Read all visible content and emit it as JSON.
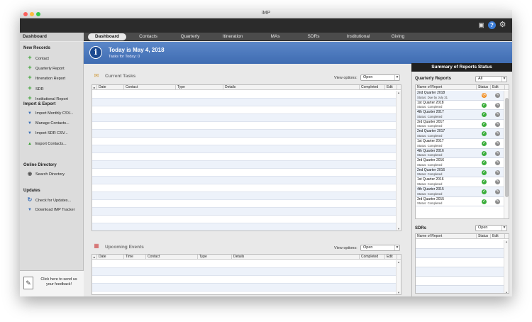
{
  "window": {
    "title": "iMP"
  },
  "toolbar": {
    "icons": [
      "inbox-icon",
      "help-icon",
      "gear-icon"
    ]
  },
  "sidebar": {
    "header": "Dashboard",
    "sections": [
      {
        "title": "New Records",
        "items": [
          {
            "label": "Contact",
            "icon": "plus-icon"
          },
          {
            "label": "Quarterly Report",
            "icon": "plus-icon"
          },
          {
            "label": "Itineration Report",
            "icon": "plus-icon"
          },
          {
            "label": "SDR",
            "icon": "plus-icon"
          },
          {
            "label": "Institutional Report",
            "icon": "plus-icon"
          }
        ]
      },
      {
        "title": "Import & Export",
        "items": [
          {
            "label": "Import Monthly CSV...",
            "icon": "download-icon"
          },
          {
            "label": "Manage Contacts...",
            "icon": "download-icon"
          },
          {
            "label": "Import SDR CSV...",
            "icon": "download-icon"
          },
          {
            "label": "Export Contacts...",
            "icon": "upload-icon"
          }
        ]
      },
      {
        "title": "Online Directory",
        "items": [
          {
            "label": "Search Directory",
            "icon": "search-icon"
          }
        ]
      },
      {
        "title": "Updates",
        "items": [
          {
            "label": "Check for Updates...",
            "icon": "refresh-icon"
          },
          {
            "label": "Download IMP Tracker",
            "icon": "download-icon"
          }
        ]
      }
    ],
    "feedback": "Click here to send us your feedback!"
  },
  "tabs": [
    "Dashboard",
    "Contacts",
    "Quarterly",
    "Itineration",
    "MAs",
    "SDRs",
    "Institutional",
    "Giving"
  ],
  "active_tab": "Dashboard",
  "banner": {
    "today": "Today is May 4, 2018",
    "tasks": "Tasks for Today: 0"
  },
  "current_tasks": {
    "title": "Current Tasks",
    "view_label": "View options:",
    "view_value": "Open",
    "columns": [
      "Date",
      "Contact",
      "Type",
      "Details",
      "Completed",
      "Edit"
    ]
  },
  "upcoming_events": {
    "title": "Upcoming Events",
    "view_label": "View options:",
    "view_value": "Open",
    "columns": [
      "Date",
      "Time",
      "Contact",
      "Type",
      "Details",
      "Completed",
      "Edit"
    ]
  },
  "summary": {
    "title": "Summary of Reports Status",
    "quarterly_label": "Quarterly Reports",
    "quarterly_filter": "All",
    "columns": [
      "Name of Report",
      "Status",
      "Edit"
    ],
    "reports": [
      {
        "name": "2nd Quarter 2018",
        "status": "Status: Due by July 31",
        "state": "pending"
      },
      {
        "name": "1st Quarter 2018",
        "status": "Status: Completed",
        "state": "completed"
      },
      {
        "name": "4th Quarter 2017",
        "status": "Status: Completed",
        "state": "completed"
      },
      {
        "name": "3rd Quarter 2017",
        "status": "Status: Completed",
        "state": "completed"
      },
      {
        "name": "2nd Quarter 2017",
        "status": "Status: Completed",
        "state": "completed"
      },
      {
        "name": "1st Quarter 2017",
        "status": "Status: Completed",
        "state": "completed"
      },
      {
        "name": "4th Quarter 2016",
        "status": "Status: Completed",
        "state": "completed"
      },
      {
        "name": "3rd Quarter 2016",
        "status": "Status: Completed",
        "state": "completed"
      },
      {
        "name": "2nd Quarter 2016",
        "status": "Status: Completed",
        "state": "completed"
      },
      {
        "name": "1st Quarter 2016",
        "status": "Status: Completed",
        "state": "completed"
      },
      {
        "name": "4th Quarter 2015",
        "status": "Status: Completed",
        "state": "completed"
      },
      {
        "name": "3rd Quarter 2015",
        "status": "Status: Completed",
        "state": "completed"
      }
    ],
    "sdrs_label": "SDRs",
    "sdrs_filter": "Open",
    "sdr_columns": [
      "Name of Report",
      "Status",
      "Edit"
    ]
  },
  "colors": {
    "accent": "#4a76bd",
    "completed": "#3cae3c",
    "pending": "#f08a1c"
  }
}
